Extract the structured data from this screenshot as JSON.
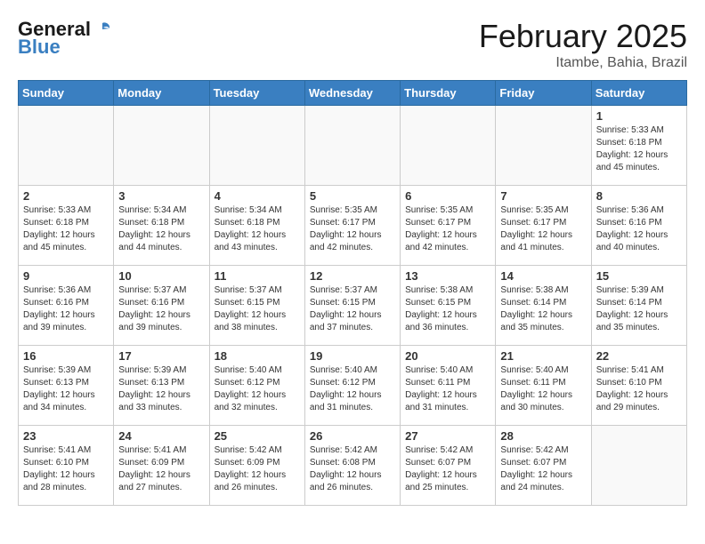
{
  "logo": {
    "line1": "General",
    "line2": "Blue"
  },
  "title": "February 2025",
  "location": "Itambe, Bahia, Brazil",
  "weekdays": [
    "Sunday",
    "Monday",
    "Tuesday",
    "Wednesday",
    "Thursday",
    "Friday",
    "Saturday"
  ],
  "weeks": [
    [
      {
        "day": "",
        "info": ""
      },
      {
        "day": "",
        "info": ""
      },
      {
        "day": "",
        "info": ""
      },
      {
        "day": "",
        "info": ""
      },
      {
        "day": "",
        "info": ""
      },
      {
        "day": "",
        "info": ""
      },
      {
        "day": "1",
        "info": "Sunrise: 5:33 AM\nSunset: 6:18 PM\nDaylight: 12 hours\nand 45 minutes."
      }
    ],
    [
      {
        "day": "2",
        "info": "Sunrise: 5:33 AM\nSunset: 6:18 PM\nDaylight: 12 hours\nand 45 minutes."
      },
      {
        "day": "3",
        "info": "Sunrise: 5:34 AM\nSunset: 6:18 PM\nDaylight: 12 hours\nand 44 minutes."
      },
      {
        "day": "4",
        "info": "Sunrise: 5:34 AM\nSunset: 6:18 PM\nDaylight: 12 hours\nand 43 minutes."
      },
      {
        "day": "5",
        "info": "Sunrise: 5:35 AM\nSunset: 6:17 PM\nDaylight: 12 hours\nand 42 minutes."
      },
      {
        "day": "6",
        "info": "Sunrise: 5:35 AM\nSunset: 6:17 PM\nDaylight: 12 hours\nand 42 minutes."
      },
      {
        "day": "7",
        "info": "Sunrise: 5:35 AM\nSunset: 6:17 PM\nDaylight: 12 hours\nand 41 minutes."
      },
      {
        "day": "8",
        "info": "Sunrise: 5:36 AM\nSunset: 6:16 PM\nDaylight: 12 hours\nand 40 minutes."
      }
    ],
    [
      {
        "day": "9",
        "info": "Sunrise: 5:36 AM\nSunset: 6:16 PM\nDaylight: 12 hours\nand 39 minutes."
      },
      {
        "day": "10",
        "info": "Sunrise: 5:37 AM\nSunset: 6:16 PM\nDaylight: 12 hours\nand 39 minutes."
      },
      {
        "day": "11",
        "info": "Sunrise: 5:37 AM\nSunset: 6:15 PM\nDaylight: 12 hours\nand 38 minutes."
      },
      {
        "day": "12",
        "info": "Sunrise: 5:37 AM\nSunset: 6:15 PM\nDaylight: 12 hours\nand 37 minutes."
      },
      {
        "day": "13",
        "info": "Sunrise: 5:38 AM\nSunset: 6:15 PM\nDaylight: 12 hours\nand 36 minutes."
      },
      {
        "day": "14",
        "info": "Sunrise: 5:38 AM\nSunset: 6:14 PM\nDaylight: 12 hours\nand 35 minutes."
      },
      {
        "day": "15",
        "info": "Sunrise: 5:39 AM\nSunset: 6:14 PM\nDaylight: 12 hours\nand 35 minutes."
      }
    ],
    [
      {
        "day": "16",
        "info": "Sunrise: 5:39 AM\nSunset: 6:13 PM\nDaylight: 12 hours\nand 34 minutes."
      },
      {
        "day": "17",
        "info": "Sunrise: 5:39 AM\nSunset: 6:13 PM\nDaylight: 12 hours\nand 33 minutes."
      },
      {
        "day": "18",
        "info": "Sunrise: 5:40 AM\nSunset: 6:12 PM\nDaylight: 12 hours\nand 32 minutes."
      },
      {
        "day": "19",
        "info": "Sunrise: 5:40 AM\nSunset: 6:12 PM\nDaylight: 12 hours\nand 31 minutes."
      },
      {
        "day": "20",
        "info": "Sunrise: 5:40 AM\nSunset: 6:11 PM\nDaylight: 12 hours\nand 31 minutes."
      },
      {
        "day": "21",
        "info": "Sunrise: 5:40 AM\nSunset: 6:11 PM\nDaylight: 12 hours\nand 30 minutes."
      },
      {
        "day": "22",
        "info": "Sunrise: 5:41 AM\nSunset: 6:10 PM\nDaylight: 12 hours\nand 29 minutes."
      }
    ],
    [
      {
        "day": "23",
        "info": "Sunrise: 5:41 AM\nSunset: 6:10 PM\nDaylight: 12 hours\nand 28 minutes."
      },
      {
        "day": "24",
        "info": "Sunrise: 5:41 AM\nSunset: 6:09 PM\nDaylight: 12 hours\nand 27 minutes."
      },
      {
        "day": "25",
        "info": "Sunrise: 5:42 AM\nSunset: 6:09 PM\nDaylight: 12 hours\nand 26 minutes."
      },
      {
        "day": "26",
        "info": "Sunrise: 5:42 AM\nSunset: 6:08 PM\nDaylight: 12 hours\nand 26 minutes."
      },
      {
        "day": "27",
        "info": "Sunrise: 5:42 AM\nSunset: 6:07 PM\nDaylight: 12 hours\nand 25 minutes."
      },
      {
        "day": "28",
        "info": "Sunrise: 5:42 AM\nSunset: 6:07 PM\nDaylight: 12 hours\nand 24 minutes."
      },
      {
        "day": "",
        "info": ""
      }
    ]
  ]
}
